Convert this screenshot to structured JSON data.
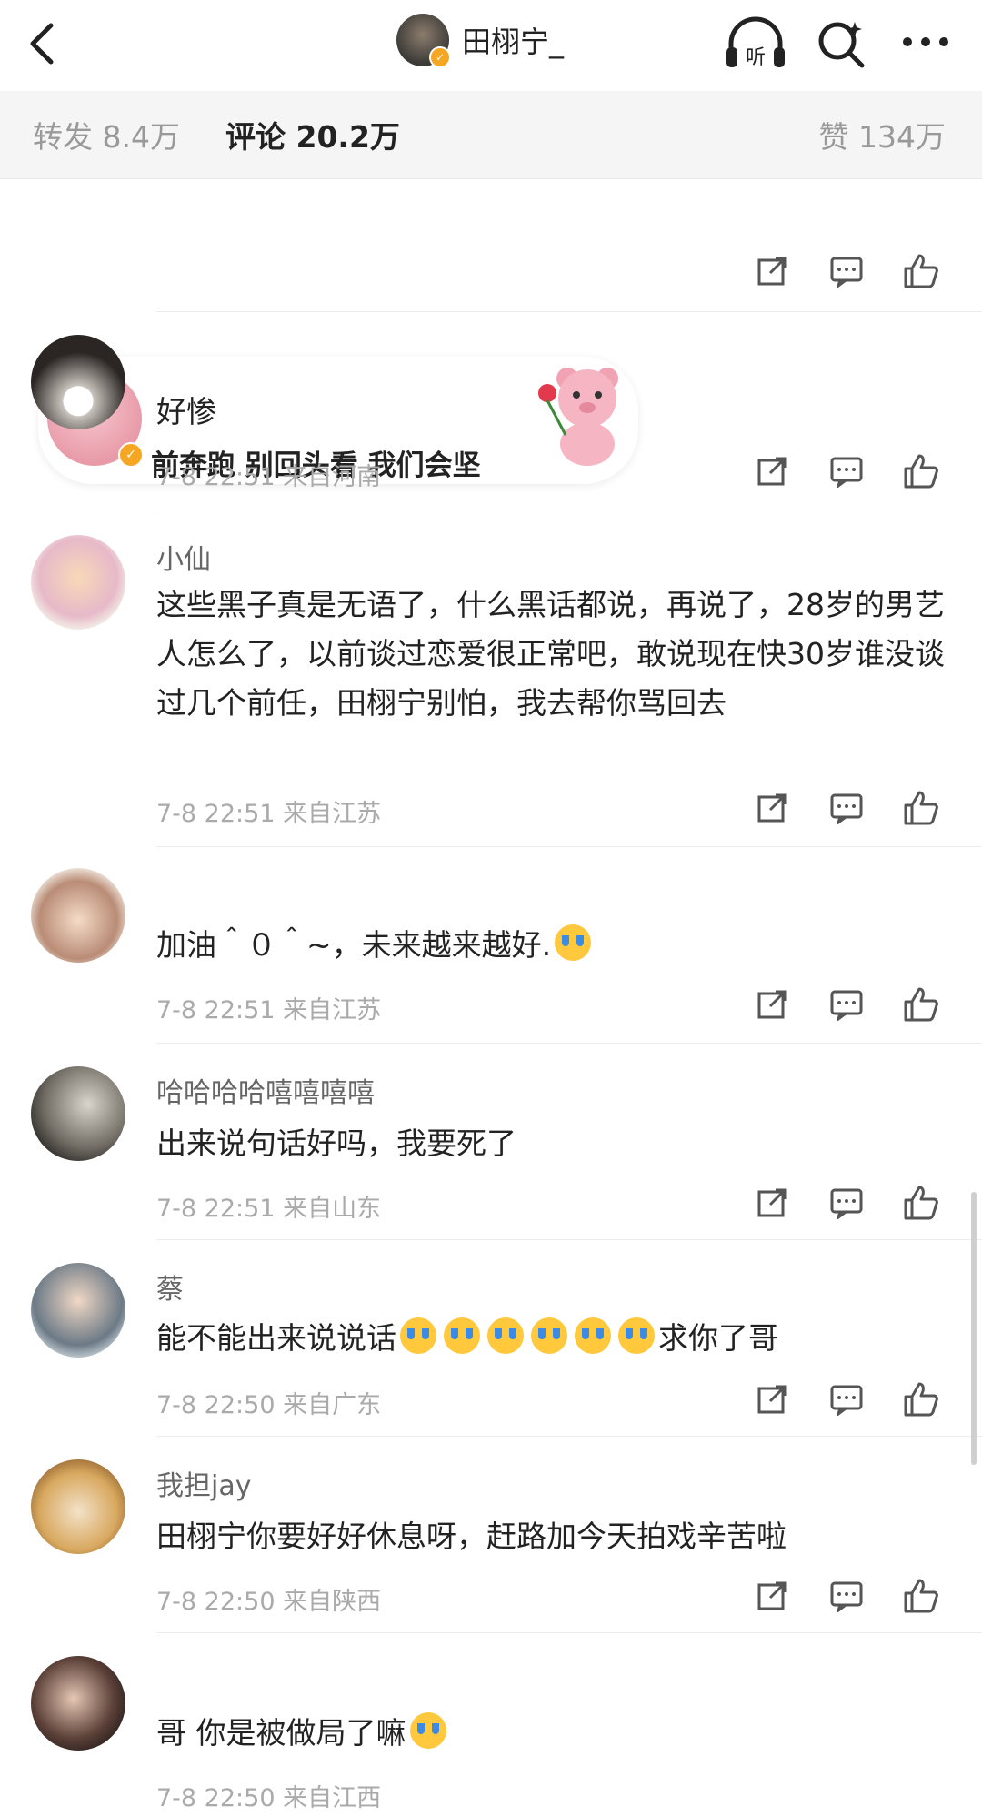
{
  "header": {
    "profile_name": "田栩宁_",
    "listen_label": "听"
  },
  "stats": {
    "repost": "转发 8.4万",
    "comment": "评论 20.2万",
    "like": "赞 134万"
  },
  "sticker_comment": {
    "text": "前奔跑 别回头看 我们会坚"
  },
  "comments": [
    {
      "username": "",
      "text": "好惨",
      "time": "7-8 22:51",
      "location": "来自河南"
    },
    {
      "username": "小仙",
      "text": "这些黑子真是无语了，什么黑话都说，再说了，28岁的男艺人怎么了，以前谈过恋爱很正常吧，敢说现在快30岁谁没谈过几个前任，田栩宁别怕，我去帮你骂回去",
      "time": "7-8 22:51",
      "location": "来自江苏"
    },
    {
      "username": "",
      "text": "加油＾０＾~，未来越来越好.",
      "time": "7-8 22:51",
      "location": "来自江苏"
    },
    {
      "username": "哈哈哈哈嘻嘻嘻嘻",
      "text": "出来说句话好吗，我要死了",
      "time": "7-8 22:51",
      "location": "来自山东"
    },
    {
      "username": "蔡",
      "text_before": "能不能出来说说话",
      "text_after": "求你了哥",
      "time": "7-8 22:50",
      "location": "来自广东"
    },
    {
      "username": "我担jay",
      "text": "田栩宁你要好好休息呀，赶路加今天拍戏辛苦啦",
      "time": "7-8 22:50",
      "location": "来自陕西"
    },
    {
      "username": "",
      "text": "哥 你是被做局了嘛",
      "time": "7-8 22:50",
      "location": "来自江西"
    }
  ],
  "colors": {
    "accent": "#f5a623",
    "muted": "#aaaaaa",
    "text": "#222222"
  },
  "icons": [
    "back-icon",
    "headphones-icon",
    "search-icon",
    "more-icon",
    "share-icon",
    "comment-icon",
    "like-icon"
  ]
}
